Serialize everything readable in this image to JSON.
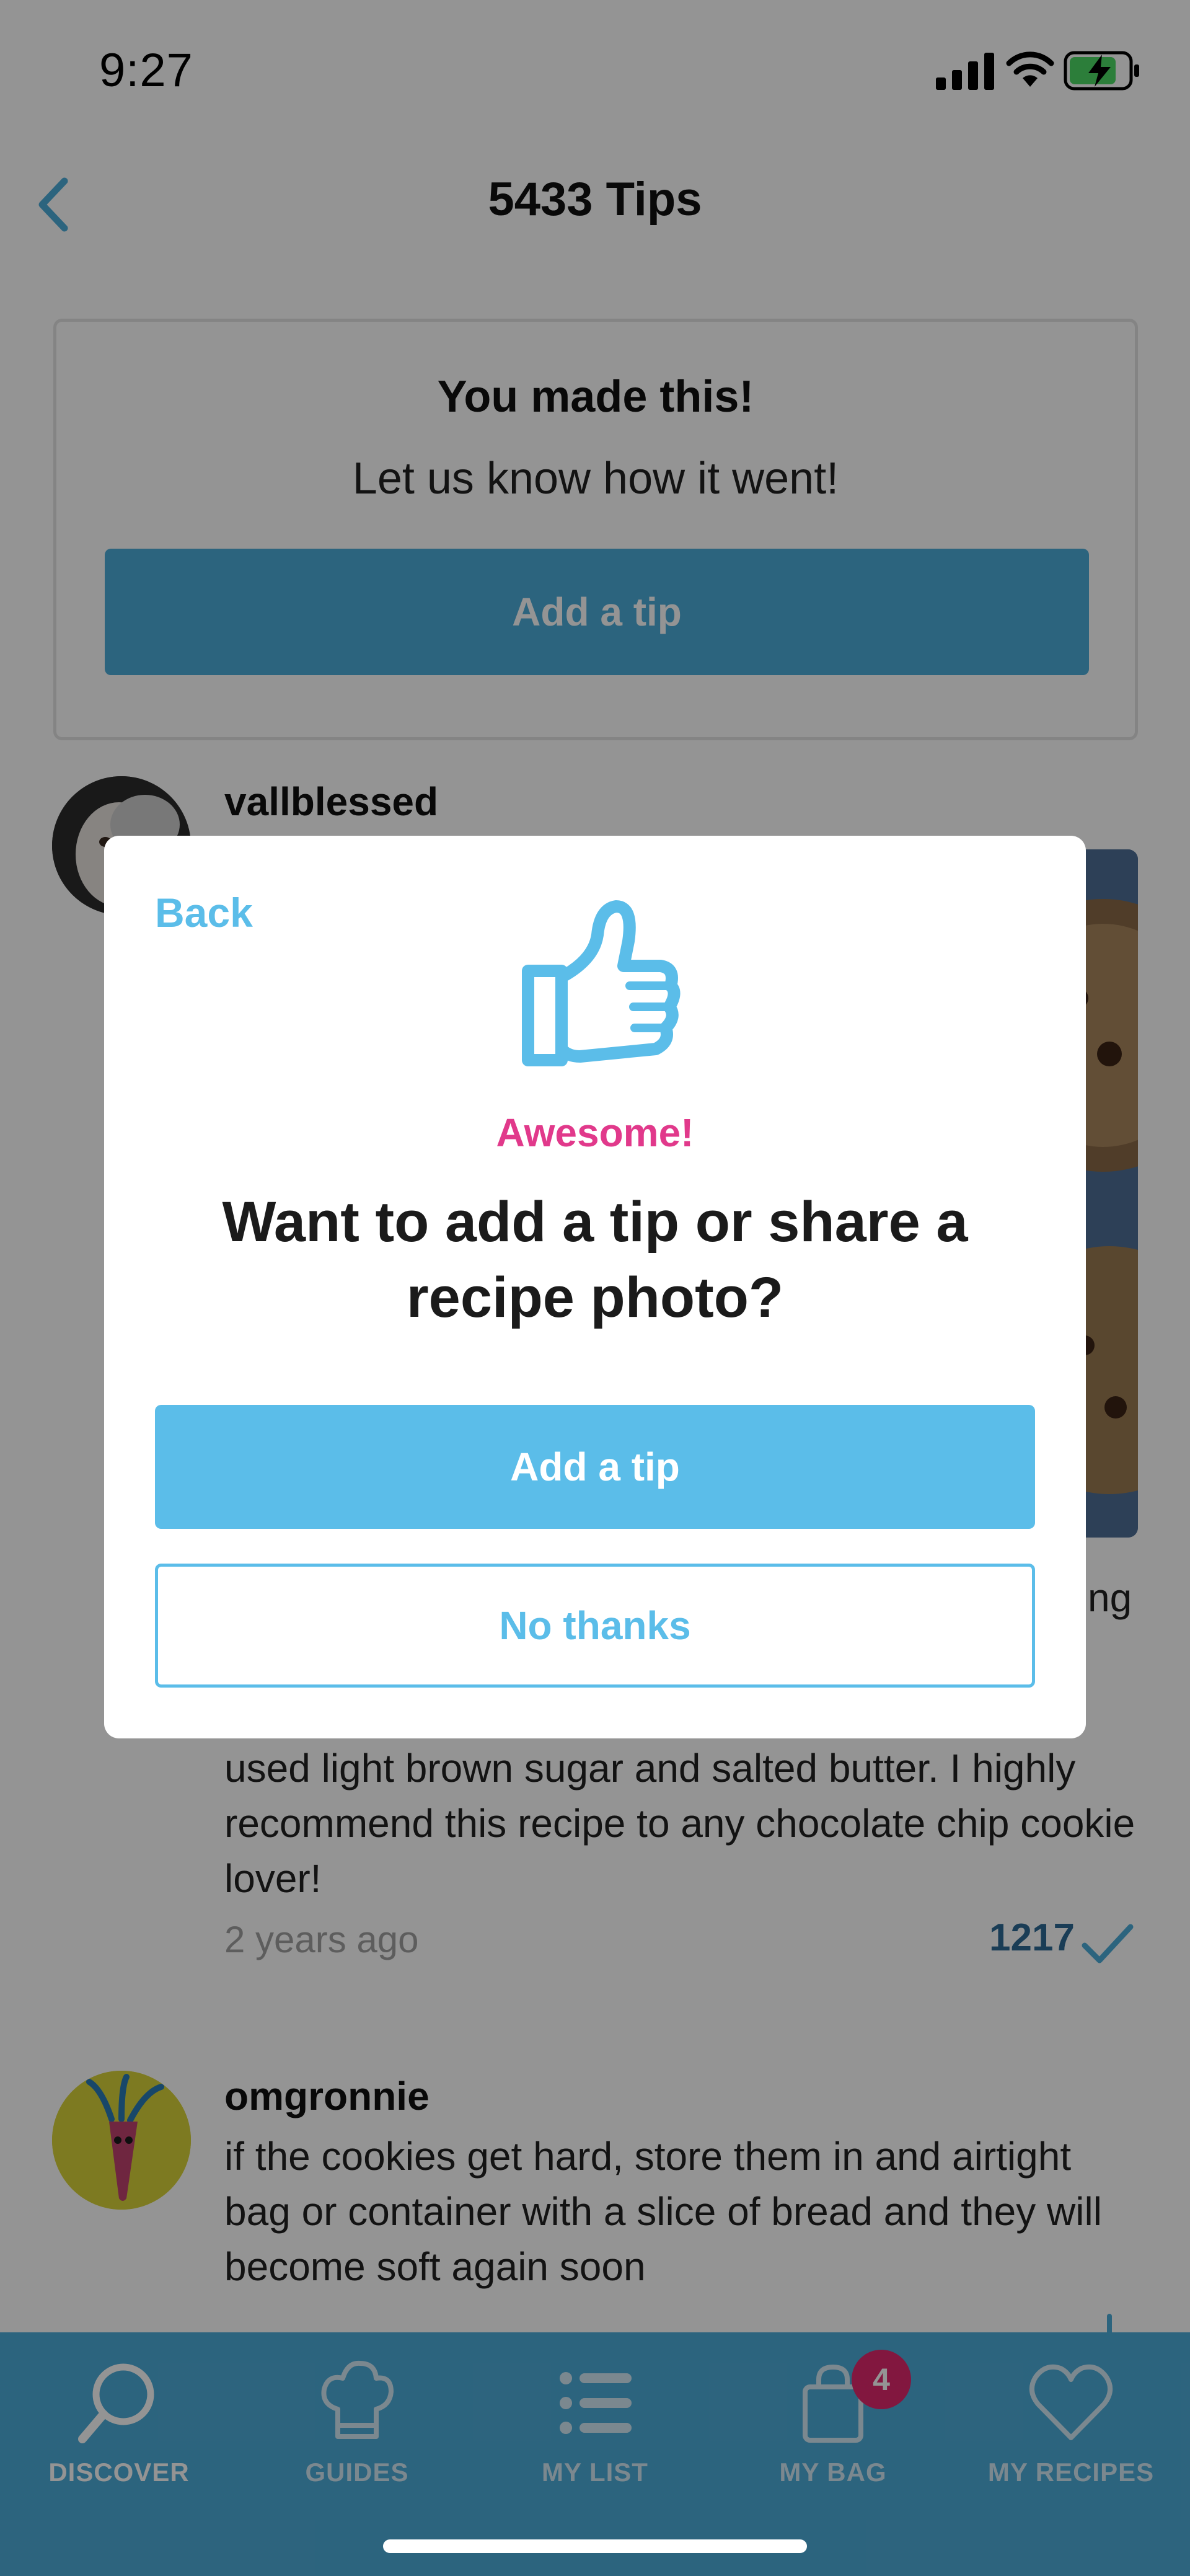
{
  "status_bar": {
    "time": "9:27"
  },
  "header": {
    "title": "5433 Tips"
  },
  "made_card": {
    "title": "You made this!",
    "subtitle": "Let us know how it went!",
    "button_label": "Add a tip"
  },
  "tips": [
    {
      "user": "vallblessed",
      "fragment": "ng",
      "text": "used light brown sugar and salted butter. I highly recommend this recipe to any chocolate chip cookie lover!",
      "time": "2 years ago",
      "helpful_count": "1217"
    },
    {
      "user": "omgronnie",
      "text": "if the cookies get hard, store them in and airtight bag or container with a slice of bread and they will become soft again soon"
    }
  ],
  "modal": {
    "back_label": "Back",
    "eyebrow": "Awesome!",
    "title": "Want to add a tip or share a recipe photo?",
    "primary_label": "Add a tip",
    "secondary_label": "No thanks"
  },
  "tab_bar": {
    "tabs": [
      {
        "label": "DISCOVER",
        "icon": "search-icon",
        "active": true
      },
      {
        "label": "GUIDES",
        "icon": "chef-hat-icon",
        "active": false
      },
      {
        "label": "MY LIST",
        "icon": "list-icon",
        "active": false
      },
      {
        "label": "MY BAG",
        "icon": "shopping-bag-icon",
        "active": false,
        "badge": "4"
      },
      {
        "label": "MY RECIPES",
        "icon": "heart-icon",
        "active": false
      }
    ]
  },
  "colors": {
    "accent": "#5bbde9",
    "tab_bar": "#4dacd9",
    "eyebrow": "#e1398b",
    "badge": "#e1296d",
    "count": "#2d6a94"
  }
}
